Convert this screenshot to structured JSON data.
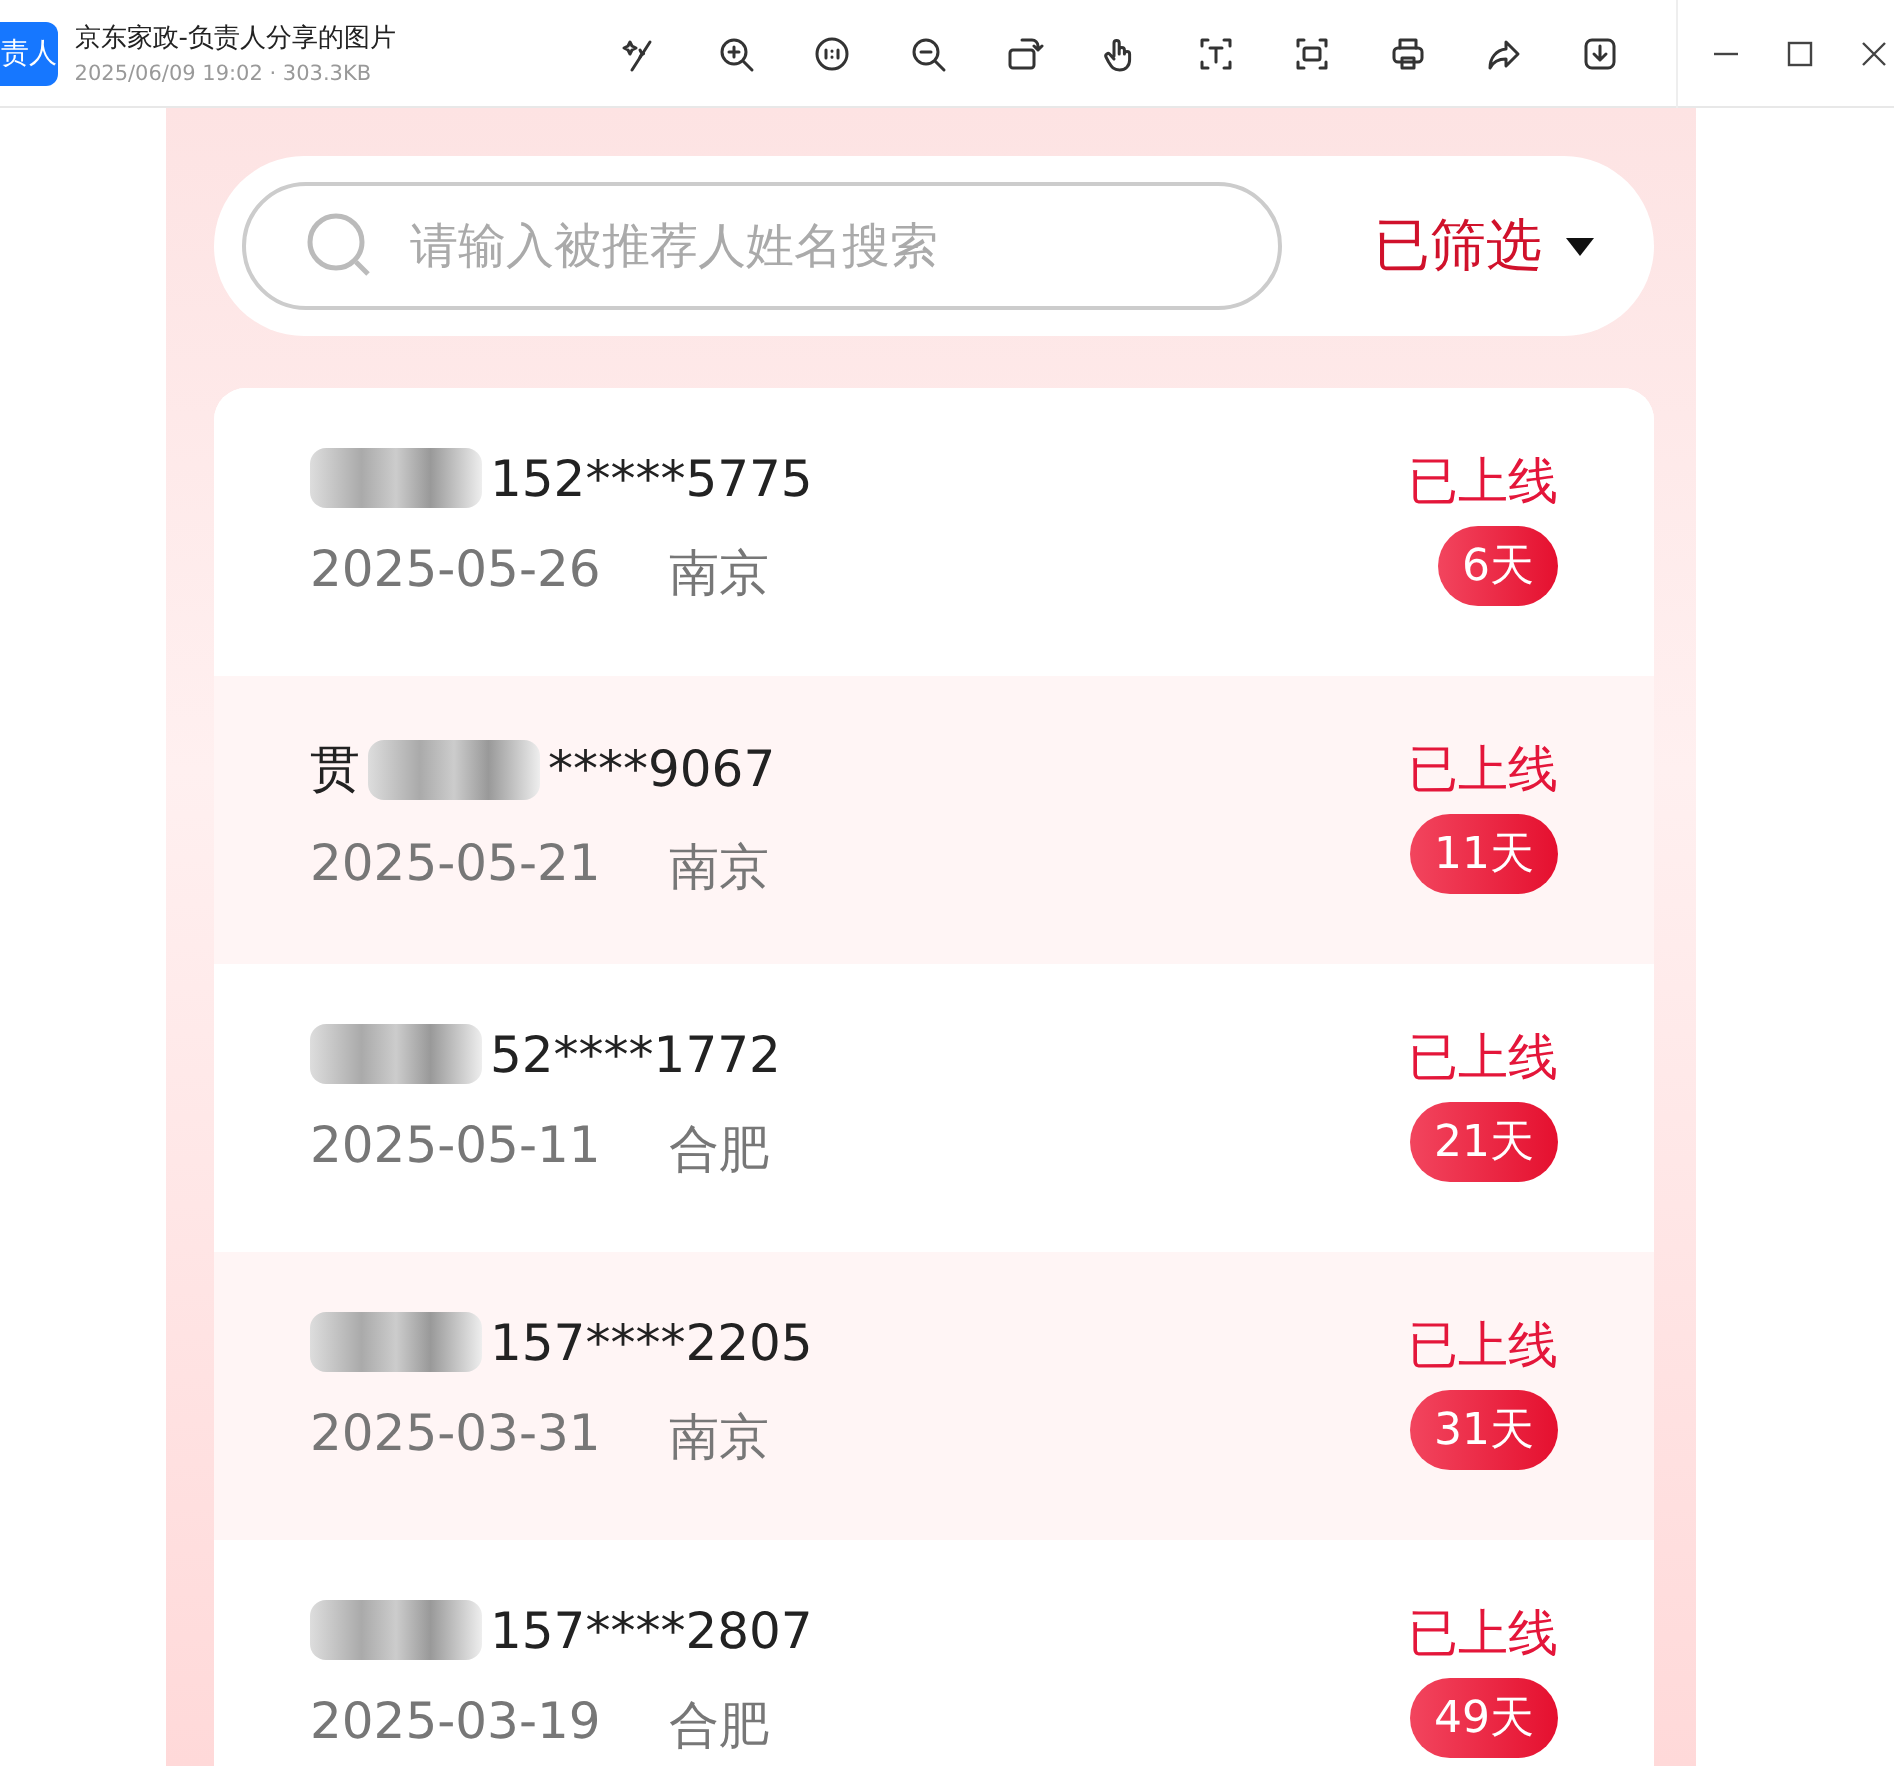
{
  "window": {
    "app_badge": "责人",
    "title": "京东家政-负责人分享的图片",
    "meta": "2025/06/09 19:02 · 303.3KB"
  },
  "search": {
    "placeholder": "请输入被推荐人姓名搜索"
  },
  "filter": {
    "label": "已筛选"
  },
  "rows": [
    {
      "phone": "152****5775",
      "date": "2025-05-26",
      "city": "南京",
      "status": "已上线",
      "days": "6天"
    },
    {
      "name": "贯",
      "phone": "****9067",
      "date": "2025-05-21",
      "city": "南京",
      "status": "已上线",
      "days": "11天"
    },
    {
      "phone": "52****1772",
      "date": "2025-05-11",
      "city": "合肥",
      "status": "已上线",
      "days": "21天"
    },
    {
      "phone": "157****2205",
      "date": "2025-03-31",
      "city": "南京",
      "status": "已上线",
      "days": "31天"
    },
    {
      "phone": "157****2807",
      "date": "2025-03-19",
      "city": "合肥",
      "status": "已上线",
      "days": "49天"
    }
  ]
}
